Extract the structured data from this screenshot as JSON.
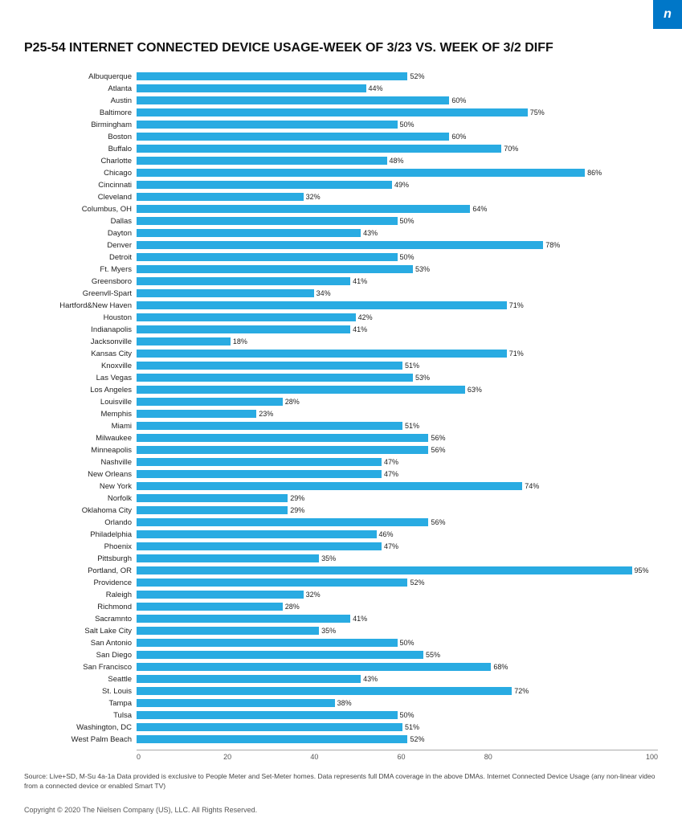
{
  "logo": "n",
  "title": "P25-54 INTERNET CONNECTED DEVICE USAGE-WEEK OF 3/23 VS. WEEK OF 3/2 DIFF",
  "bars": [
    {
      "city": "Albuquerque",
      "value": 52
    },
    {
      "city": "Atlanta",
      "value": 44
    },
    {
      "city": "Austin",
      "value": 60
    },
    {
      "city": "Baltimore",
      "value": 75
    },
    {
      "city": "Birmingham",
      "value": 50
    },
    {
      "city": "Boston",
      "value": 60
    },
    {
      "city": "Buffalo",
      "value": 70
    },
    {
      "city": "Charlotte",
      "value": 48
    },
    {
      "city": "Chicago",
      "value": 86
    },
    {
      "city": "Cincinnati",
      "value": 49
    },
    {
      "city": "Cleveland",
      "value": 32
    },
    {
      "city": "Columbus, OH",
      "value": 64
    },
    {
      "city": "Dallas",
      "value": 50
    },
    {
      "city": "Dayton",
      "value": 43
    },
    {
      "city": "Denver",
      "value": 78
    },
    {
      "city": "Detroit",
      "value": 50
    },
    {
      "city": "Ft. Myers",
      "value": 53
    },
    {
      "city": "Greensboro",
      "value": 41
    },
    {
      "city": "Greenvll-Spart",
      "value": 34
    },
    {
      "city": "Hartford&New Haven",
      "value": 71
    },
    {
      "city": "Houston",
      "value": 42
    },
    {
      "city": "Indianapolis",
      "value": 41
    },
    {
      "city": "Jacksonville",
      "value": 18
    },
    {
      "city": "Kansas City",
      "value": 71
    },
    {
      "city": "Knoxville",
      "value": 51
    },
    {
      "city": "Las Vegas",
      "value": 53
    },
    {
      "city": "Los Angeles",
      "value": 63
    },
    {
      "city": "Louisville",
      "value": 28
    },
    {
      "city": "Memphis",
      "value": 23
    },
    {
      "city": "Miami",
      "value": 51
    },
    {
      "city": "Milwaukee",
      "value": 56
    },
    {
      "city": "Minneapolis",
      "value": 56
    },
    {
      "city": "Nashville",
      "value": 47
    },
    {
      "city": "New Orleans",
      "value": 47
    },
    {
      "city": "New York",
      "value": 74
    },
    {
      "city": "Norfolk",
      "value": 29
    },
    {
      "city": "Oklahoma City",
      "value": 29
    },
    {
      "city": "Orlando",
      "value": 56
    },
    {
      "city": "Philadelphia",
      "value": 46
    },
    {
      "city": "Phoenix",
      "value": 47
    },
    {
      "city": "Pittsburgh",
      "value": 35
    },
    {
      "city": "Portland, OR",
      "value": 95
    },
    {
      "city": "Providence",
      "value": 52
    },
    {
      "city": "Raleigh",
      "value": 32
    },
    {
      "city": "Richmond",
      "value": 28
    },
    {
      "city": "Sacramnto",
      "value": 41
    },
    {
      "city": "Salt Lake City",
      "value": 35
    },
    {
      "city": "San Antonio",
      "value": 50
    },
    {
      "city": "San Diego",
      "value": 55
    },
    {
      "city": "San Francisco",
      "value": 68
    },
    {
      "city": "Seattle",
      "value": 43
    },
    {
      "city": "St. Louis",
      "value": 72
    },
    {
      "city": "Tampa",
      "value": 38
    },
    {
      "city": "Tulsa",
      "value": 50
    },
    {
      "city": "Washington, DC",
      "value": 51
    },
    {
      "city": "West Palm Beach",
      "value": 52
    }
  ],
  "x_axis": {
    "ticks": [
      "0",
      "20",
      "40",
      "60",
      "80",
      "100"
    ]
  },
  "source": "Source: Live+SD, M-Su 4a-1a Data provided is exclusive to People Meter and Set-Meter homes. Data represents full DMA coverage in the above DMAs. Internet Connected Device Usage (any non-linear video from a connected device or enabled Smart TV)",
  "copyright": "Copyright © 2020 The Nielsen Company (US), LLC. All Rights Reserved."
}
